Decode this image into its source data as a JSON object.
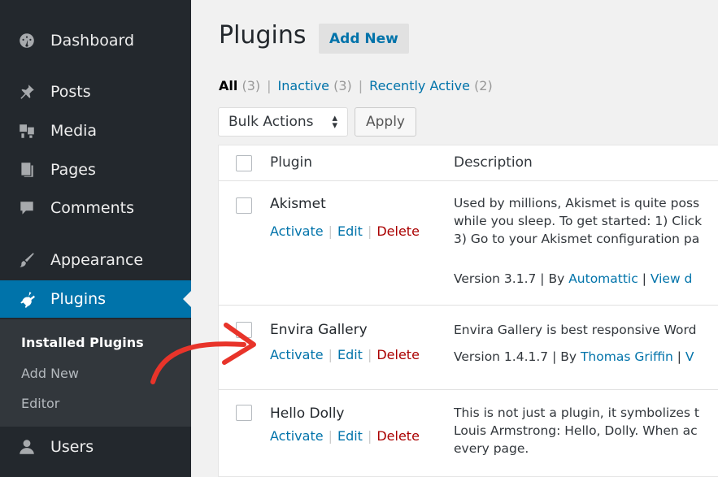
{
  "sidebar": {
    "items": [
      {
        "label": "Dashboard",
        "icon": "dashboard-icon"
      },
      {
        "label": "Posts",
        "icon": "pin-icon"
      },
      {
        "label": "Media",
        "icon": "media-icon"
      },
      {
        "label": "Pages",
        "icon": "pages-icon"
      },
      {
        "label": "Comments",
        "icon": "comment-icon"
      },
      {
        "label": "Appearance",
        "icon": "brush-icon"
      },
      {
        "label": "Plugins",
        "icon": "plugin-icon"
      },
      {
        "label": "Users",
        "icon": "user-icon"
      }
    ],
    "submenu": [
      "Installed Plugins",
      "Add New",
      "Editor"
    ]
  },
  "header": {
    "title": "Plugins",
    "add_new": "Add New"
  },
  "filters": {
    "all": "All",
    "all_count": "(3)",
    "inactive": "Inactive",
    "inactive_count": "(3)",
    "recent": "Recently Active",
    "recent_count": "(2)",
    "sep": "|"
  },
  "bulk": {
    "select": "Bulk Actions",
    "arrows": "▴▾",
    "apply": "Apply"
  },
  "table": {
    "col_plugin": "Plugin",
    "col_description": "Description",
    "actions": {
      "activate": "Activate",
      "edit": "Edit",
      "delete": "Delete",
      "sep": "|"
    },
    "rows": [
      {
        "name": "Akismet",
        "desc_lines": [
          "Used by millions, Akismet is quite poss",
          "while you sleep. To get started: 1) Click",
          "3) Go to your Akismet configuration pa"
        ],
        "version": "Version 3.1.7 | By ",
        "author": "Automattic",
        "after": " | ",
        "view": "View d"
      },
      {
        "name": "Envira Gallery",
        "desc_lines": [
          "Envira Gallery is best responsive Word"
        ],
        "version": "Version 1.4.1.7 | By ",
        "author": "Thomas Griffin",
        "after": " | ",
        "view": "V"
      },
      {
        "name": "Hello Dolly",
        "desc_lines": [
          "This is not just a plugin, it symbolizes t",
          "Louis Armstrong: Hello, Dolly. When ac",
          "every page."
        ]
      }
    ]
  },
  "colors": {
    "sidebar": "#23282d",
    "submenu": "#32373c",
    "accent": "#0073aa",
    "delete": "#a00",
    "annotation_arrow": "#e8342a"
  }
}
